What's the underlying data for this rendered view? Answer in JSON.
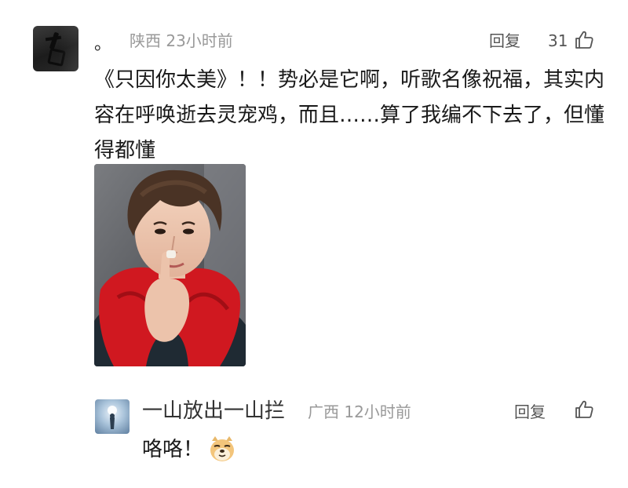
{
  "comment": {
    "username": "。",
    "location": "陕西",
    "time": "23小时前",
    "reply_label": "回复",
    "like_count": "31",
    "text": "《只因你太美》！！势必是它啊，听歌名像祝福，其实内容在呼唤逝去灵宠鸡，而且……算了我编不下去了，但懂得都懂",
    "image_alt": "",
    "icons": {
      "like": "thumbs-up-icon"
    }
  },
  "reply": {
    "username": "一山放出一山拦",
    "location": "广西",
    "time": "12小时前",
    "reply_label": "回复",
    "text": "咯咯！",
    "emoji": "doge-emoji",
    "icons": {
      "like": "thumbs-up-icon"
    }
  },
  "colors": {
    "meta": "#999999",
    "text": "#1a1a1a",
    "scarf": "#d01820"
  }
}
